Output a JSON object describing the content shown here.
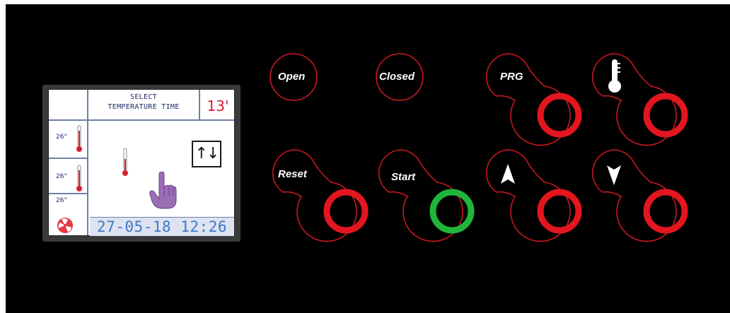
{
  "display": {
    "header_line1": "SELECT",
    "header_line2": "TEMPERATURE TIME",
    "counter": "13'",
    "zone_temps": [
      "26°",
      "26°",
      "26°"
    ],
    "arrows_symbol": "↑↓",
    "datetime": "27-05-18 12:26",
    "icons": [
      "thermometer-icon",
      "hand-pointer-icon",
      "fan-icon",
      "up-down-arrows-icon"
    ]
  },
  "buttons": {
    "open": "Open",
    "closed": "Closed",
    "prg": "PRG",
    "reset": "Reset",
    "start": "Start",
    "thermometer": "thermometer-icon",
    "up": "up-arrow-icon",
    "down": "down-arrow-icon"
  },
  "colors": {
    "ring_red": "#e3161f",
    "ring_green": "#1fb53a",
    "outline_red": "#c81820",
    "panel": "#000000",
    "lcd_blue": "#3e78c9",
    "counter_red": "#d8202c",
    "hand_purple": "#9a6db5"
  }
}
